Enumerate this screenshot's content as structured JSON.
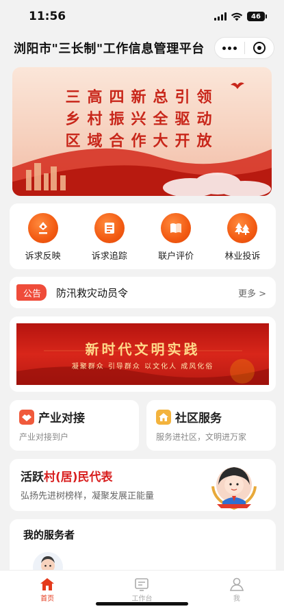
{
  "status_bar": {
    "time": "11:56",
    "battery": "46"
  },
  "nav": {
    "title": "浏阳市\"三长制\"工作信息管理平台",
    "more_icon": "more-dots-icon",
    "close_icon": "target-icon"
  },
  "banner": {
    "lines": [
      "三高四新总引领",
      "乡村振兴全驱动",
      "区域合作大开放"
    ]
  },
  "quick_actions": [
    {
      "label": "诉求反映",
      "icon": "pen-icon"
    },
    {
      "label": "诉求追踪",
      "icon": "document-icon"
    },
    {
      "label": "联户评价",
      "icon": "book-icon"
    },
    {
      "label": "林业投诉",
      "icon": "tree-icon"
    }
  ],
  "notice": {
    "tag": "公告",
    "text": "防汛救灾动员令",
    "more": "更多 >"
  },
  "civilization_banner": {
    "title": "新时代文明实践",
    "subtitle": "凝聚群众 引导群众 以文化人 成风化俗"
  },
  "service_cards": [
    {
      "title": "产业对接",
      "subtitle": "产业对接到户",
      "icon": "handshake-icon",
      "color": "#f05a3c"
    },
    {
      "title": "社区服务",
      "subtitle": "服务进社区，文明进万家",
      "icon": "house-icon",
      "color": "#f3b33d"
    }
  ],
  "representative": {
    "title_prefix": "活跃",
    "title_highlight": "村(居)民代表",
    "subtitle": "弘扬先进树榜样，凝聚发展正能量"
  },
  "servers": {
    "title": "我的服务者"
  },
  "tabs": [
    {
      "label": "首页",
      "icon": "home-icon",
      "active": true
    },
    {
      "label": "工作台",
      "icon": "workbench-icon",
      "active": false
    },
    {
      "label": "我",
      "icon": "person-icon",
      "active": false
    }
  ],
  "colors": {
    "accent": "#e4391b",
    "tag_red": "#ef4c3a",
    "highlight_red": "#d81e1e"
  }
}
